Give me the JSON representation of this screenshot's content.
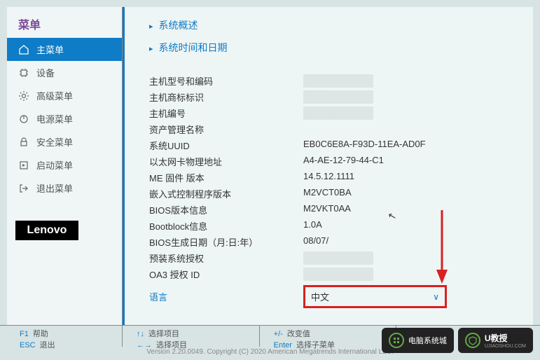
{
  "sidebar": {
    "title": "菜单",
    "items": [
      {
        "label": "主菜单",
        "icon": "home"
      },
      {
        "label": "设备",
        "icon": "chip"
      },
      {
        "label": "高级菜单",
        "icon": "gear"
      },
      {
        "label": "电源菜单",
        "icon": "power"
      },
      {
        "label": "安全菜单",
        "icon": "lock"
      },
      {
        "label": "启动菜单",
        "icon": "boot"
      },
      {
        "label": "退出菜单",
        "icon": "exit"
      }
    ]
  },
  "logo": "Lenovo",
  "nav": {
    "link1": "系统概述",
    "link2": "系统时间和日期"
  },
  "info": {
    "rows": [
      {
        "label": "主机型号和编码",
        "value": "",
        "blurred": true
      },
      {
        "label": "主机商标标识",
        "value": "",
        "blurred": true
      },
      {
        "label": "主机编号",
        "value": "",
        "blurred": true
      },
      {
        "label": "资产管理名称",
        "value": ""
      },
      {
        "label": "系统UUID",
        "value": "EB0C6E8A-F93D-11EA-AD0F"
      },
      {
        "label": "以太网卡物理地址",
        "value": "A4-AE-12-79-44-C1"
      },
      {
        "label": "ME 固件 版本",
        "value": "14.5.12.1111"
      },
      {
        "label": "嵌入式控制程序版本",
        "value": "M2VCT0BA"
      },
      {
        "label": "BIOS版本信息",
        "value": "M2VKT0AA"
      },
      {
        "label": "Bootblock信息",
        "value": "1.0A"
      },
      {
        "label": "BIOS生成日期（月:日:年）",
        "value": "08/07/"
      },
      {
        "label": "预装系统授权",
        "value": "",
        "blurred": true
      },
      {
        "label": "OA3 授权 ID",
        "value": "",
        "blurred": true
      }
    ],
    "language_label": "语言",
    "language_value": "中文"
  },
  "footer": {
    "f1": "F1",
    "f1_label": "帮助",
    "esc": "ESC",
    "esc_label": "退出",
    "arrows1": "↑↓",
    "arrows1_label": "选择项目",
    "arrows2": "←→",
    "arrows2_label": "选择项目",
    "pm": "+/-",
    "pm_label": "改变值",
    "enter": "Enter",
    "enter_label": "选择子菜单",
    "copyright": "Version 2.20.0049. Copyright (C) 2020 American Megatrends International LLC."
  },
  "badges": {
    "b1": "电脑系统城",
    "b2": "U教授",
    "b2_sub": "UJIAOSHOU.COM"
  }
}
